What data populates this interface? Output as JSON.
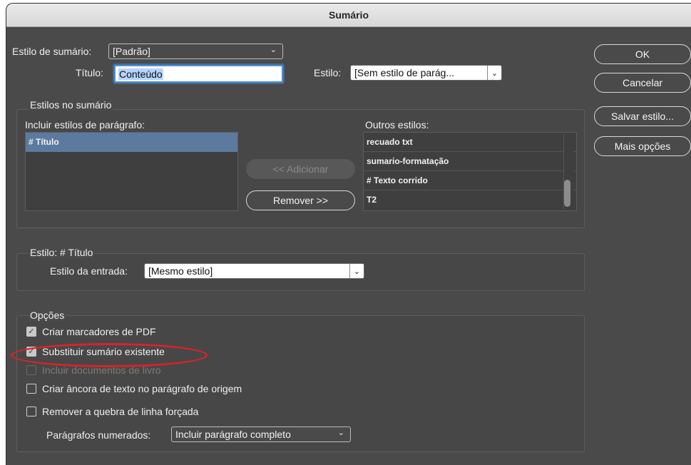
{
  "window": {
    "title": "Sumário"
  },
  "top": {
    "style_label": "Estilo de sumário:",
    "style_value": "[Padrão]",
    "title_label": "Título:",
    "title_value": "Conteúdo",
    "estilo_label": "Estilo:",
    "estilo_value": "[Sem estilo de parág..."
  },
  "styles_group": {
    "title": "Estilos no sumário",
    "include_label": "Incluir estilos de parágrafo:",
    "include_items": [
      "# Título"
    ],
    "add_button": "<< Adicionar",
    "remove_button": "Remover >>",
    "other_label": "Outros estilos:",
    "other_items": [
      "recuado txt",
      "sumario-formatação",
      "# Texto corrido",
      "T2"
    ]
  },
  "style_group": {
    "title": "Estilo: # Título",
    "entry_label": "Estilo da entrada:",
    "entry_value": "[Mesmo estilo]"
  },
  "options": {
    "title": "Opções",
    "pdf_bookmarks": {
      "label": "Criar marcadores de PDF",
      "checked": true
    },
    "replace_existing": {
      "label": "Substituir sumário existente",
      "checked": true
    },
    "include_book": {
      "label": "Incluir documentos de livro",
      "checked": false,
      "disabled": true
    },
    "anchor": {
      "label": "Criar âncora de texto no parágrafo de origem",
      "checked": false
    },
    "remove_break": {
      "label": "Remover a quebra de linha forçada",
      "checked": false
    },
    "numbered_label": "Parágrafos numerados:",
    "numbered_value": "Incluir parágrafo completo"
  },
  "buttons": {
    "ok": "OK",
    "cancel": "Cancelar",
    "save_style": "Salvar estilo...",
    "more_options": "Mais opções"
  },
  "annotation": {
    "highlight_color": "#d8232a"
  }
}
